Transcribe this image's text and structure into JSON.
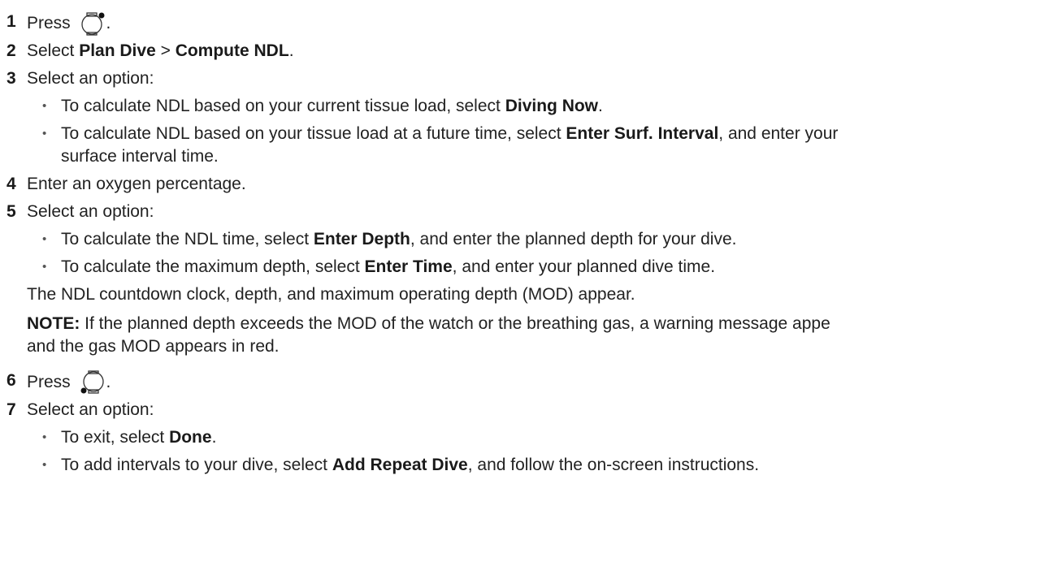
{
  "steps": [
    {
      "number": "1",
      "text": "Press",
      "suffix": ".",
      "icon": "watch-button-top-right-icon"
    },
    {
      "number": "2",
      "parts": [
        "Select ",
        "Plan Dive",
        " > ",
        "Compute NDL",
        "."
      ]
    },
    {
      "number": "3",
      "text": "Select an option:",
      "bullets": [
        {
          "parts": [
            "To calculate NDL based on your current tissue load, select ",
            "Diving Now",
            "."
          ]
        },
        {
          "parts": [
            "To calculate NDL based on your tissue load at a future time, select ",
            "Enter Surf. Interval",
            ", and enter your"
          ],
          "continuation": "surface interval time."
        }
      ]
    },
    {
      "number": "4",
      "text": "Enter an oxygen percentage."
    },
    {
      "number": "5",
      "text": "Select an option:",
      "bullets": [
        {
          "parts": [
            "To calculate the NDL time, select ",
            "Enter Depth",
            ", and enter the planned depth for your dive."
          ]
        },
        {
          "parts": [
            "To calculate the maximum depth, select ",
            "Enter Time",
            ", and enter your planned dive time."
          ]
        }
      ],
      "result": "The NDL countdown clock, depth, and maximum operating depth (MOD) appear.",
      "note": {
        "label": "NOTE:",
        "text": " If the planned depth exceeds the MOD of the watch or the breathing gas, a warning message appe",
        "continuation": "and the gas MOD appears in red."
      }
    },
    {
      "number": "6",
      "text": "Press",
      "suffix": ".",
      "icon": "watch-button-bottom-left-icon"
    },
    {
      "number": "7",
      "text": "Select an option:",
      "bullets": [
        {
          "parts": [
            "To exit, select ",
            "Done",
            "."
          ]
        },
        {
          "parts": [
            "To add intervals to your dive, select ",
            "Add Repeat Dive",
            ", and follow the on-screen instructions."
          ]
        }
      ]
    }
  ]
}
